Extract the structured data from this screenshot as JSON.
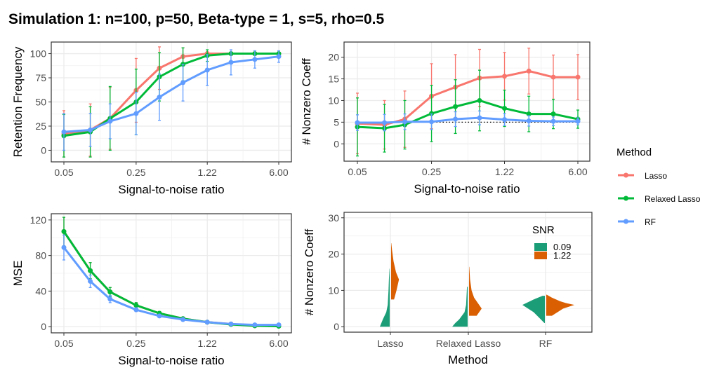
{
  "title": "Simulation 1: n=100, p=50, Beta-type = 1, s=5, rho=0.5",
  "colors": {
    "Lasso": "#F8766D",
    "Relaxed Lasso": "#00BA38",
    "RF": "#619CFF",
    "snr_low": "#1B9E77",
    "snr_high": "#D95F02"
  },
  "legend": {
    "title": "Method",
    "items": [
      "Lasso",
      "Relaxed Lasso",
      "RF"
    ],
    "placement": "right"
  },
  "chart_data": [
    {
      "type": "line",
      "xlabel": "Signal-to-noise ratio",
      "ylabel": "Retention Frequency",
      "x": [
        0.05,
        0.09,
        0.14,
        0.25,
        0.42,
        0.71,
        1.22,
        2.07,
        3.52,
        6.0
      ],
      "x_scale": "log",
      "xticks": [
        "0.05",
        "0.25",
        "1.22",
        "6.00"
      ],
      "yticks": [
        0,
        25,
        50,
        75,
        100
      ],
      "ylim": [
        -12,
        112
      ],
      "grid": true,
      "series": [
        {
          "name": "Lasso",
          "values": [
            17,
            21,
            33,
            62,
            85,
            97,
            100,
            100,
            100,
            100
          ],
          "sd": [
            24,
            27,
            32,
            33,
            22,
            9,
            2,
            1,
            1,
            1
          ]
        },
        {
          "name": "Relaxed Lasso",
          "values": [
            15,
            19,
            33,
            50,
            76,
            89,
            98,
            100,
            100,
            100
          ],
          "sd": [
            22,
            26,
            33,
            34,
            25,
            17,
            6,
            1,
            1,
            1
          ]
        },
        {
          "name": "RF",
          "values": [
            19,
            21,
            30,
            38,
            55,
            70,
            83,
            91,
            94,
            97
          ],
          "sd": [
            19,
            17,
            18,
            22,
            24,
            19,
            16,
            13,
            9,
            6
          ]
        }
      ]
    },
    {
      "type": "line",
      "xlabel": "Signal-to-noise ratio",
      "ylabel": "# Nonzero Coeff",
      "x": [
        0.05,
        0.09,
        0.14,
        0.25,
        0.42,
        0.71,
        1.22,
        2.07,
        3.52,
        6.0
      ],
      "x_scale": "log",
      "xticks": [
        "0.05",
        "0.25",
        "1.22",
        "6.00"
      ],
      "yticks": [
        0,
        5,
        10,
        15,
        20
      ],
      "ylim": [
        -4,
        23.5
      ],
      "grid": true,
      "reference_line": 5,
      "series": [
        {
          "name": "Lasso",
          "values": [
            4.7,
            4.4,
            5.7,
            11,
            13.1,
            15.2,
            15.6,
            16.8,
            15.4,
            15.4
          ],
          "sd": [
            7,
            5.6,
            6.5,
            7.5,
            7.5,
            6.6,
            5.5,
            5.3,
            5.1,
            5.2
          ]
        },
        {
          "name": "Relaxed Lasso",
          "values": [
            3.9,
            3.6,
            4.4,
            7,
            8.6,
            10,
            8.2,
            6.9,
            6.9,
            5.7
          ],
          "sd": [
            6.7,
            5.5,
            5.6,
            6.5,
            6.2,
            7,
            4.2,
            4.1,
            3.4,
            2.1
          ]
        },
        {
          "name": "RF",
          "values": [
            4.9,
            4.9,
            5.1,
            5.1,
            5.7,
            6.0,
            5.6,
            5.3,
            5.2,
            5.2
          ],
          "sd": [
            1.8,
            1.9,
            1.8,
            1.8,
            1.7,
            1.6,
            1.4,
            1.2,
            1,
            0.8
          ]
        }
      ]
    },
    {
      "type": "line",
      "xlabel": "Signal-to-noise ratio",
      "ylabel": "MSE",
      "x": [
        0.05,
        0.09,
        0.14,
        0.25,
        0.42,
        0.71,
        1.22,
        2.07,
        3.52,
        6.0
      ],
      "x_scale": "log",
      "xticks": [
        "0.05",
        "0.25",
        "1.22",
        "6.00"
      ],
      "yticks": [
        0,
        40,
        80,
        120
      ],
      "ylim": [
        -7,
        127
      ],
      "grid": true,
      "series": [
        {
          "name": "Lasso",
          "values": [
            107,
            63,
            39,
            24,
            15,
            9,
            5,
            3,
            1,
            1
          ],
          "sd": [
            16,
            9,
            5,
            3,
            2,
            1,
            0.5,
            0.3,
            0.2,
            0.2
          ]
        },
        {
          "name": "Relaxed Lasso",
          "values": [
            107,
            63,
            39,
            24,
            15,
            9,
            5,
            2.5,
            1,
            0.5
          ],
          "sd": [
            16,
            9,
            5,
            3,
            2,
            1,
            0.5,
            0.3,
            0.2,
            0.2
          ]
        },
        {
          "name": "RF",
          "values": [
            89,
            51,
            31,
            19,
            12,
            8,
            5,
            3,
            2,
            2
          ],
          "sd": [
            14,
            7,
            4,
            2,
            1.5,
            1,
            0.5,
            0.3,
            0.2,
            0.2
          ]
        }
      ]
    },
    {
      "type": "violin",
      "xlabel": "Method",
      "ylabel": "# Nonzero Coeff",
      "categories": [
        "Lasso",
        "Relaxed Lasso",
        "RF"
      ],
      "yticks": [
        0,
        10,
        20,
        30
      ],
      "ylim": [
        -1.5,
        31.5
      ],
      "grid": true,
      "legend": {
        "title": "SNR",
        "items": [
          "0.09",
          "1.22"
        ],
        "placement": "top-right"
      },
      "series": [
        {
          "name": "0.09",
          "side": "left",
          "densities": [
            [
              [
                0,
                1
              ],
              [
                2,
                0.7
              ],
              [
                4,
                0.35
              ],
              [
                6,
                0.2
              ],
              [
                10,
                0.12
              ],
              [
                13,
                0.08
              ],
              [
                16,
                0.02
              ]
            ],
            [
              [
                0,
                1
              ],
              [
                1,
                0.8
              ],
              [
                2,
                0.55
              ],
              [
                4,
                0.2
              ],
              [
                6,
                0.1
              ],
              [
                11,
                0.04
              ]
            ],
            [
              [
                1,
                0.02
              ],
              [
                4,
                0.5
              ],
              [
                6,
                1
              ],
              [
                7.5,
                0.5
              ],
              [
                8.5,
                0.1
              ]
            ]
          ]
        },
        {
          "name": "1.22",
          "side": "right",
          "densities": [
            [
              [
                7.5,
                0.3
              ],
              [
                10,
                0.55
              ],
              [
                13,
                0.8
              ],
              [
                15,
                0.5
              ],
              [
                18,
                0.25
              ],
              [
                21,
                0.1
              ],
              [
                23,
                0.02
              ]
            ],
            [
              [
                3,
                0.6
              ],
              [
                5,
                1
              ],
              [
                6,
                0.8
              ],
              [
                8,
                0.4
              ],
              [
                10,
                0.2
              ],
              [
                13,
                0.08
              ],
              [
                16.5,
                0.02
              ]
            ],
            [
              [
                3,
                0.2
              ],
              [
                5,
                0.6
              ],
              [
                5.5,
                0.8
              ],
              [
                6,
                1
              ],
              [
                6.5,
                0.7
              ],
              [
                7,
                0.5
              ],
              [
                8,
                0.2
              ],
              [
                8.8,
                0.02
              ]
            ]
          ]
        }
      ]
    }
  ]
}
